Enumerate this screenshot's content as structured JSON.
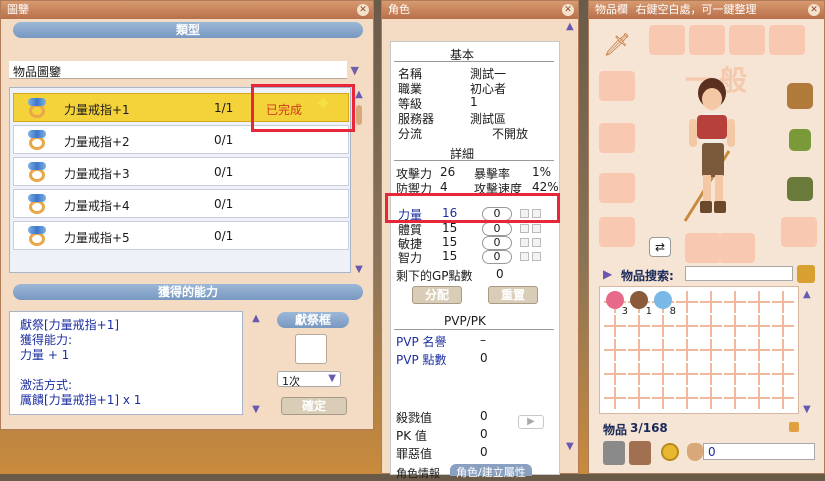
{
  "collection_window": {
    "title": "圖鑒",
    "category_header": "類型",
    "dropdown_value": "物品圖鑒",
    "items": [
      {
        "name": "力量戒指+1",
        "count": "1/1",
        "status": "已完成"
      },
      {
        "name": "力量戒指+2",
        "count": "0/1",
        "status": ""
      },
      {
        "name": "力量戒指+3",
        "count": "0/1",
        "status": ""
      },
      {
        "name": "力量戒指+4",
        "count": "0/1",
        "status": ""
      },
      {
        "name": "力量戒指+5",
        "count": "0/1",
        "status": ""
      }
    ],
    "ability_header": "獲得的能力",
    "ability_text": [
      "獻祭[力量戒指+1]",
      "獲得能力:",
      "力量 + 1",
      "",
      "激活方式:",
      "厲饋[力量戒指+1] x 1"
    ],
    "offer_label": "獻祭框",
    "times_value": "1次",
    "confirm_label": "確定"
  },
  "character_window": {
    "title": "角色",
    "basic_header": "基本",
    "basic_rows": [
      {
        "label": "名稱",
        "value": "測試一"
      },
      {
        "label": "職業",
        "value": "初心者"
      },
      {
        "label": "等級",
        "value": "1"
      },
      {
        "label": "服務器",
        "value": "測試區"
      },
      {
        "label": "分流",
        "value": "不開放"
      }
    ],
    "detail_header": "詳細",
    "detail_rows": [
      {
        "l1": "攻擊力",
        "v1": "26",
        "l2": "暴擊率",
        "v2": "1%"
      },
      {
        "l1": "防禦力",
        "v1": "4",
        "l2": "攻擊速度",
        "v2": "42%"
      }
    ],
    "stats": [
      {
        "label": "力量",
        "value": "16",
        "input": "0"
      },
      {
        "label": "體質",
        "value": "15",
        "input": "0"
      },
      {
        "label": "敏捷",
        "value": "15",
        "input": "0"
      },
      {
        "label": "智力",
        "value": "15",
        "input": "0"
      }
    ],
    "gp_label": "剩下的GP點數",
    "gp_value": "0",
    "assign_label": "分配",
    "reset_label": "重置",
    "pvp_header": "PVP/PK",
    "pvp_rows": [
      {
        "label": "PVP 名譽",
        "value": "–"
      },
      {
        "label": "PVP 點數",
        "value": "0"
      }
    ],
    "pk_rows": [
      {
        "label": "殺戮值",
        "value": "0"
      },
      {
        "label": "PK  值",
        "value": "0"
      },
      {
        "label": "罪惡值",
        "value": "0"
      }
    ],
    "bottom_tabs": [
      "角色情報",
      "角色/建立屬性"
    ]
  },
  "inventory_window": {
    "title": "物品欄",
    "title_hint": "右鍵空白處，可一鍵整理",
    "level_banner": "一般",
    "search_label": "物品搜索:",
    "search_value": "",
    "items": [
      {
        "icon": "lollipop-icon",
        "qty": "3"
      },
      {
        "icon": "cookie-icon",
        "qty": "1"
      },
      {
        "icon": "crystal-icon",
        "qty": "8"
      }
    ],
    "count_label": "物品",
    "count_value": "3/168",
    "gold_value": "0"
  }
}
